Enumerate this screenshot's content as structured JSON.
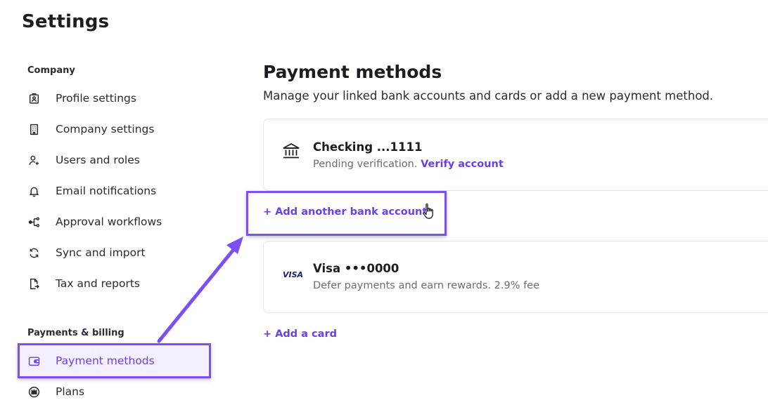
{
  "page": {
    "title": "Settings"
  },
  "sidebar": {
    "sections": [
      {
        "label": "Company",
        "items": [
          {
            "label": "Profile settings",
            "icon": "id-badge-icon"
          },
          {
            "label": "Company settings",
            "icon": "building-icon"
          },
          {
            "label": "Users and roles",
            "icon": "user-plus-icon"
          },
          {
            "label": "Email notifications",
            "icon": "bell-icon"
          },
          {
            "label": "Approval workflows",
            "icon": "workflow-icon"
          },
          {
            "label": "Sync and import",
            "icon": "sync-icon"
          },
          {
            "label": "Tax and reports",
            "icon": "document-export-icon"
          }
        ]
      },
      {
        "label": "Payments & billing",
        "items": [
          {
            "label": "Payment methods",
            "icon": "wallet-icon",
            "active": true
          },
          {
            "label": "Plans",
            "icon": "crown-icon"
          }
        ]
      }
    ]
  },
  "main": {
    "title": "Payment methods",
    "subtitle": "Manage your linked bank accounts and cards or add a new payment method.",
    "bank_account": {
      "icon": "bank-icon",
      "title": "Checking ...1111",
      "status": "Pending verification.",
      "action": "Verify account"
    },
    "add_bank_label": "+ Add another bank account",
    "card": {
      "icon": "visa-logo",
      "brand_text": "VISA",
      "title": "Visa •••0000",
      "description": "Defer payments and earn rewards. 2.9% fee"
    },
    "add_card_label": "+ Add a card"
  },
  "colors": {
    "accent": "#6a3ff0",
    "highlight": "#7c4ff5",
    "active_bg": "#f3efff",
    "muted_text": "#6b6b76",
    "border": "#e3e3e8"
  }
}
